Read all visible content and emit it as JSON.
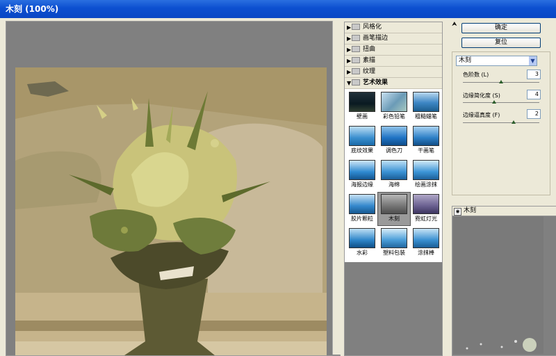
{
  "window": {
    "title": "木刻  (100%)"
  },
  "colors": {
    "titlebar": "#0c4fd0",
    "panel": "#ece9d8",
    "canvas_gray": "#808080"
  },
  "gallery": {
    "categories": [
      {
        "label": "风格化"
      },
      {
        "label": "画笔描边"
      },
      {
        "label": "扭曲"
      },
      {
        "label": "素描"
      },
      {
        "label": "纹理"
      },
      {
        "label": "艺术效果"
      }
    ],
    "thumbnails": [
      {
        "label": "壁画"
      },
      {
        "label": "彩色铅笔"
      },
      {
        "label": "粗糙蜡笔"
      },
      {
        "label": "底纹效果"
      },
      {
        "label": "调色刀"
      },
      {
        "label": "干画笔"
      },
      {
        "label": "海报边缘"
      },
      {
        "label": "海绵"
      },
      {
        "label": "绘画涂抹"
      },
      {
        "label": "胶片颗粒"
      },
      {
        "label": "木刻"
      },
      {
        "label": "霓虹灯光"
      },
      {
        "label": "水彩"
      },
      {
        "label": "塑料包装"
      },
      {
        "label": "涂抹棒"
      }
    ],
    "selected": "木刻"
  },
  "controls": {
    "ok_label": "确定",
    "reset_label": "复位",
    "filter_select": "木刻",
    "params": [
      {
        "label": "色阶数 (L)",
        "value": "3",
        "level": 0.5
      },
      {
        "label": "边缘简化度 (S)",
        "value": "4",
        "level": 0.4
      },
      {
        "label": "边缘逼真度 (F)",
        "value": "2",
        "level": 0.67
      }
    ]
  },
  "layers": {
    "items": [
      {
        "label": "木刻"
      }
    ]
  }
}
